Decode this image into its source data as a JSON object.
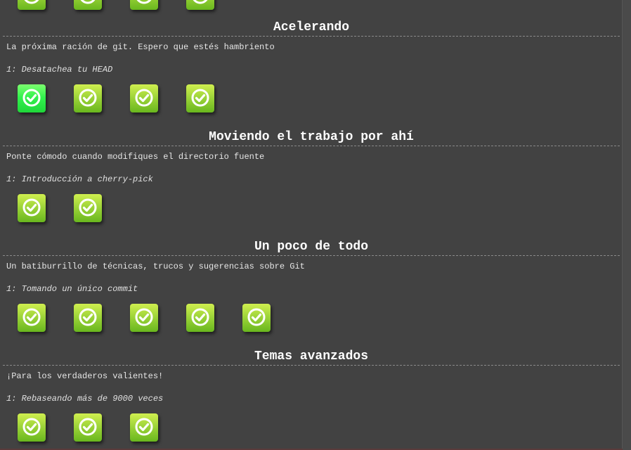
{
  "sections": [
    {
      "title": "",
      "description": "",
      "current_level": "",
      "levels_completed": 4,
      "selected_level": null
    },
    {
      "title": "Acelerando",
      "description": "La próxima ración de git. Espero que estés hambriento",
      "current_level": "1: Desatachea tu HEAD",
      "levels_completed": 4,
      "selected_level": 1
    },
    {
      "title": "Moviendo el trabajo por ahí",
      "description": "Ponte cómodo cuando modifiques el directorio fuente",
      "current_level": "1: Introducción a cherry-pick",
      "levels_completed": 2,
      "selected_level": null
    },
    {
      "title": "Un poco de todo",
      "description": "Un batiburrillo de técnicas, trucos y sugerencias sobre Git",
      "current_level": "1: Tomando un único commit",
      "levels_completed": 5,
      "selected_level": null
    },
    {
      "title": "Temas avanzados",
      "description": "¡Para los verdaderos valientes!",
      "current_level": "1: Rebaseando más de 9000 veces",
      "levels_completed": 3,
      "selected_level": null
    }
  ],
  "icon": "check-circle-icon",
  "colors": {
    "background": "#454545",
    "level_complete": "#9fd53a",
    "level_selected": "#33f24e",
    "text": "#eeeeee"
  }
}
